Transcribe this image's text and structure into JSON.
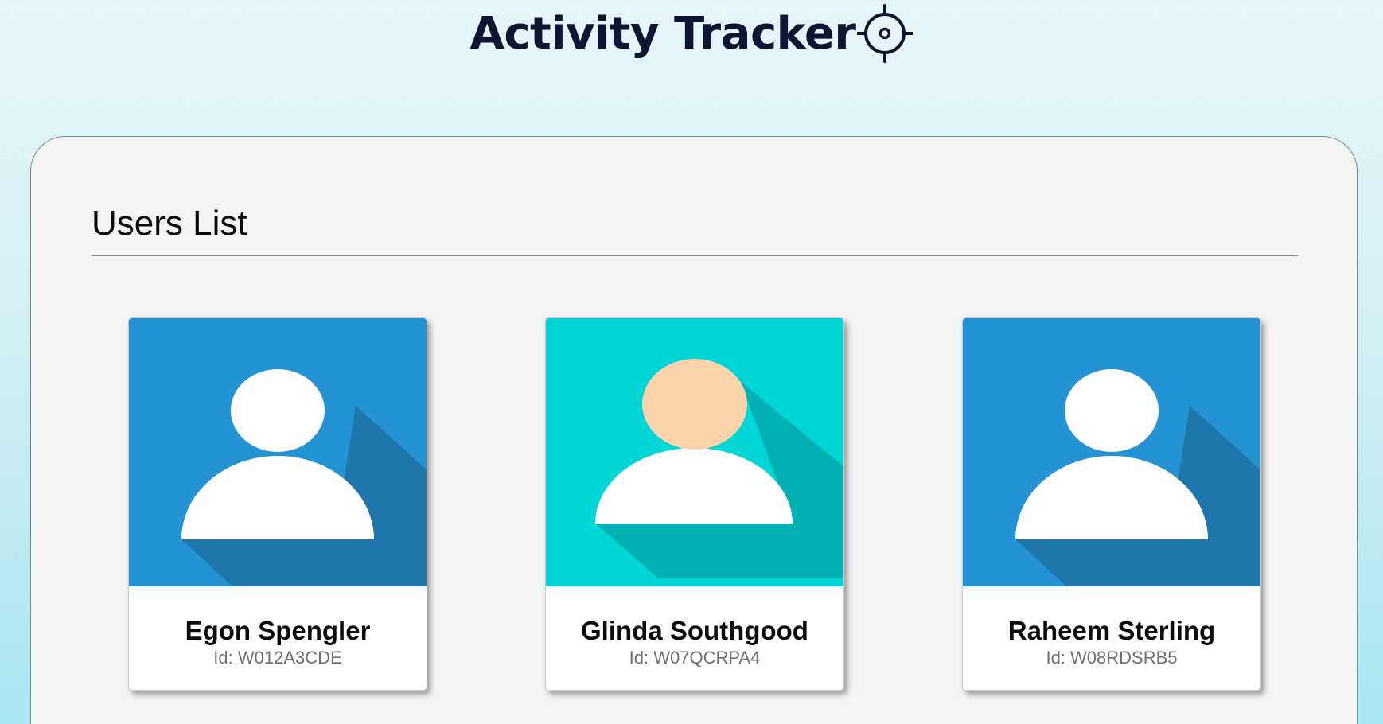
{
  "header": {
    "title": "Activity Tracker",
    "icon": "target-icon"
  },
  "users_section": {
    "title": "Users List",
    "users": [
      {
        "name": "Egon Spengler",
        "id_label": "Id:",
        "id": "W012A3CDE",
        "avatar_bg": "#2393d3",
        "avatar_shadow": "#1e76ab",
        "avatar_head": "#ffffff"
      },
      {
        "name": "Glinda Southgood",
        "id_label": "Id:",
        "id": "W07QCRPA4",
        "avatar_bg": "#00d6d6",
        "avatar_shadow": "#00b0b3",
        "avatar_head": "#fdd3ab"
      },
      {
        "name": "Raheem Sterling",
        "id_label": "Id:",
        "id": "W08RDSRB5",
        "avatar_bg": "#2393d3",
        "avatar_shadow": "#1e76ab",
        "avatar_head": "#ffffff"
      }
    ]
  },
  "colors": {
    "title_text": "#0f1430",
    "panel_bg": "#f2f3f3",
    "page_bg_top": "#e6f5f8",
    "page_bg_bottom": "#a9e6ef"
  }
}
